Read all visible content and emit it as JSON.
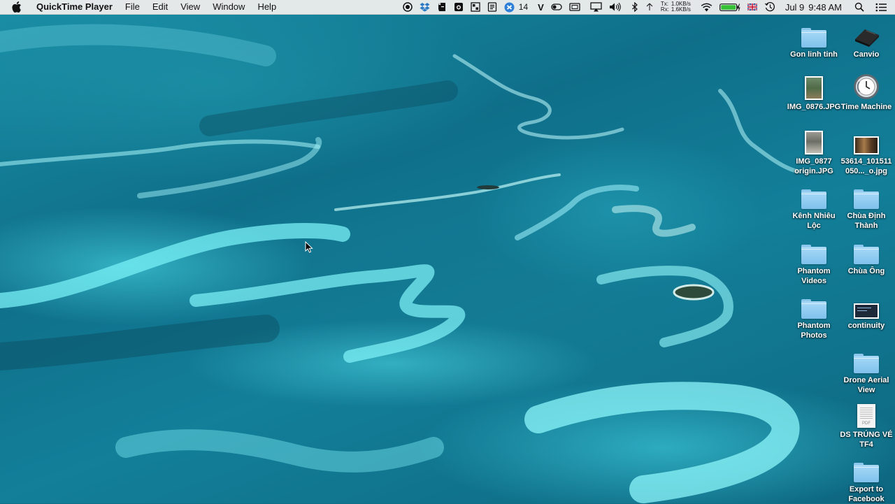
{
  "menubar": {
    "app_name": "QuickTime Player",
    "menus": [
      "File",
      "Edit",
      "View",
      "Window",
      "Help"
    ],
    "status": {
      "badge_count": "14",
      "v_label": "V",
      "net_tx_label": "Tx:",
      "net_rx_label": "Rx:",
      "net_tx": "1.0KB/s",
      "net_rx": "1.6KB/s",
      "date": "Jul 9",
      "time": "9:48 AM",
      "battery_color": "#35c135"
    }
  },
  "desktop": {
    "icons": [
      {
        "label": "Gon linh tinh",
        "icon": "folder-icon"
      },
      {
        "label": "Canvio",
        "icon": "external-drive-icon"
      },
      {
        "label": "IMG_0876.JPG",
        "icon": "image-file-icon"
      },
      {
        "label": "Time Machine",
        "icon": "time-machine-icon"
      },
      {
        "label": "IMG_0877 origin.JPG",
        "icon": "image-file-icon"
      },
      {
        "label": "53614_101511050..._o.jpg",
        "icon": "image-file-icon"
      },
      {
        "label": "Kênh Nhiêu Lộc",
        "icon": "folder-icon"
      },
      {
        "label": "Chùa Định Thành",
        "icon": "folder-icon"
      },
      {
        "label": "Phantom Videos",
        "icon": "folder-icon"
      },
      {
        "label": "Chùa Ông",
        "icon": "folder-icon"
      },
      {
        "label": "Phantom Photos",
        "icon": "folder-icon"
      },
      {
        "label": "continuity",
        "icon": "screenshot-file-icon"
      },
      {
        "label": "Drone Aerial View",
        "icon": "folder-icon"
      },
      {
        "label": "DS TRÚNG VÉ TF4",
        "icon": "pdf-file-icon"
      },
      {
        "label": "Export to Facebook",
        "icon": "folder-icon"
      }
    ],
    "pdf_tag": "PDF"
  }
}
